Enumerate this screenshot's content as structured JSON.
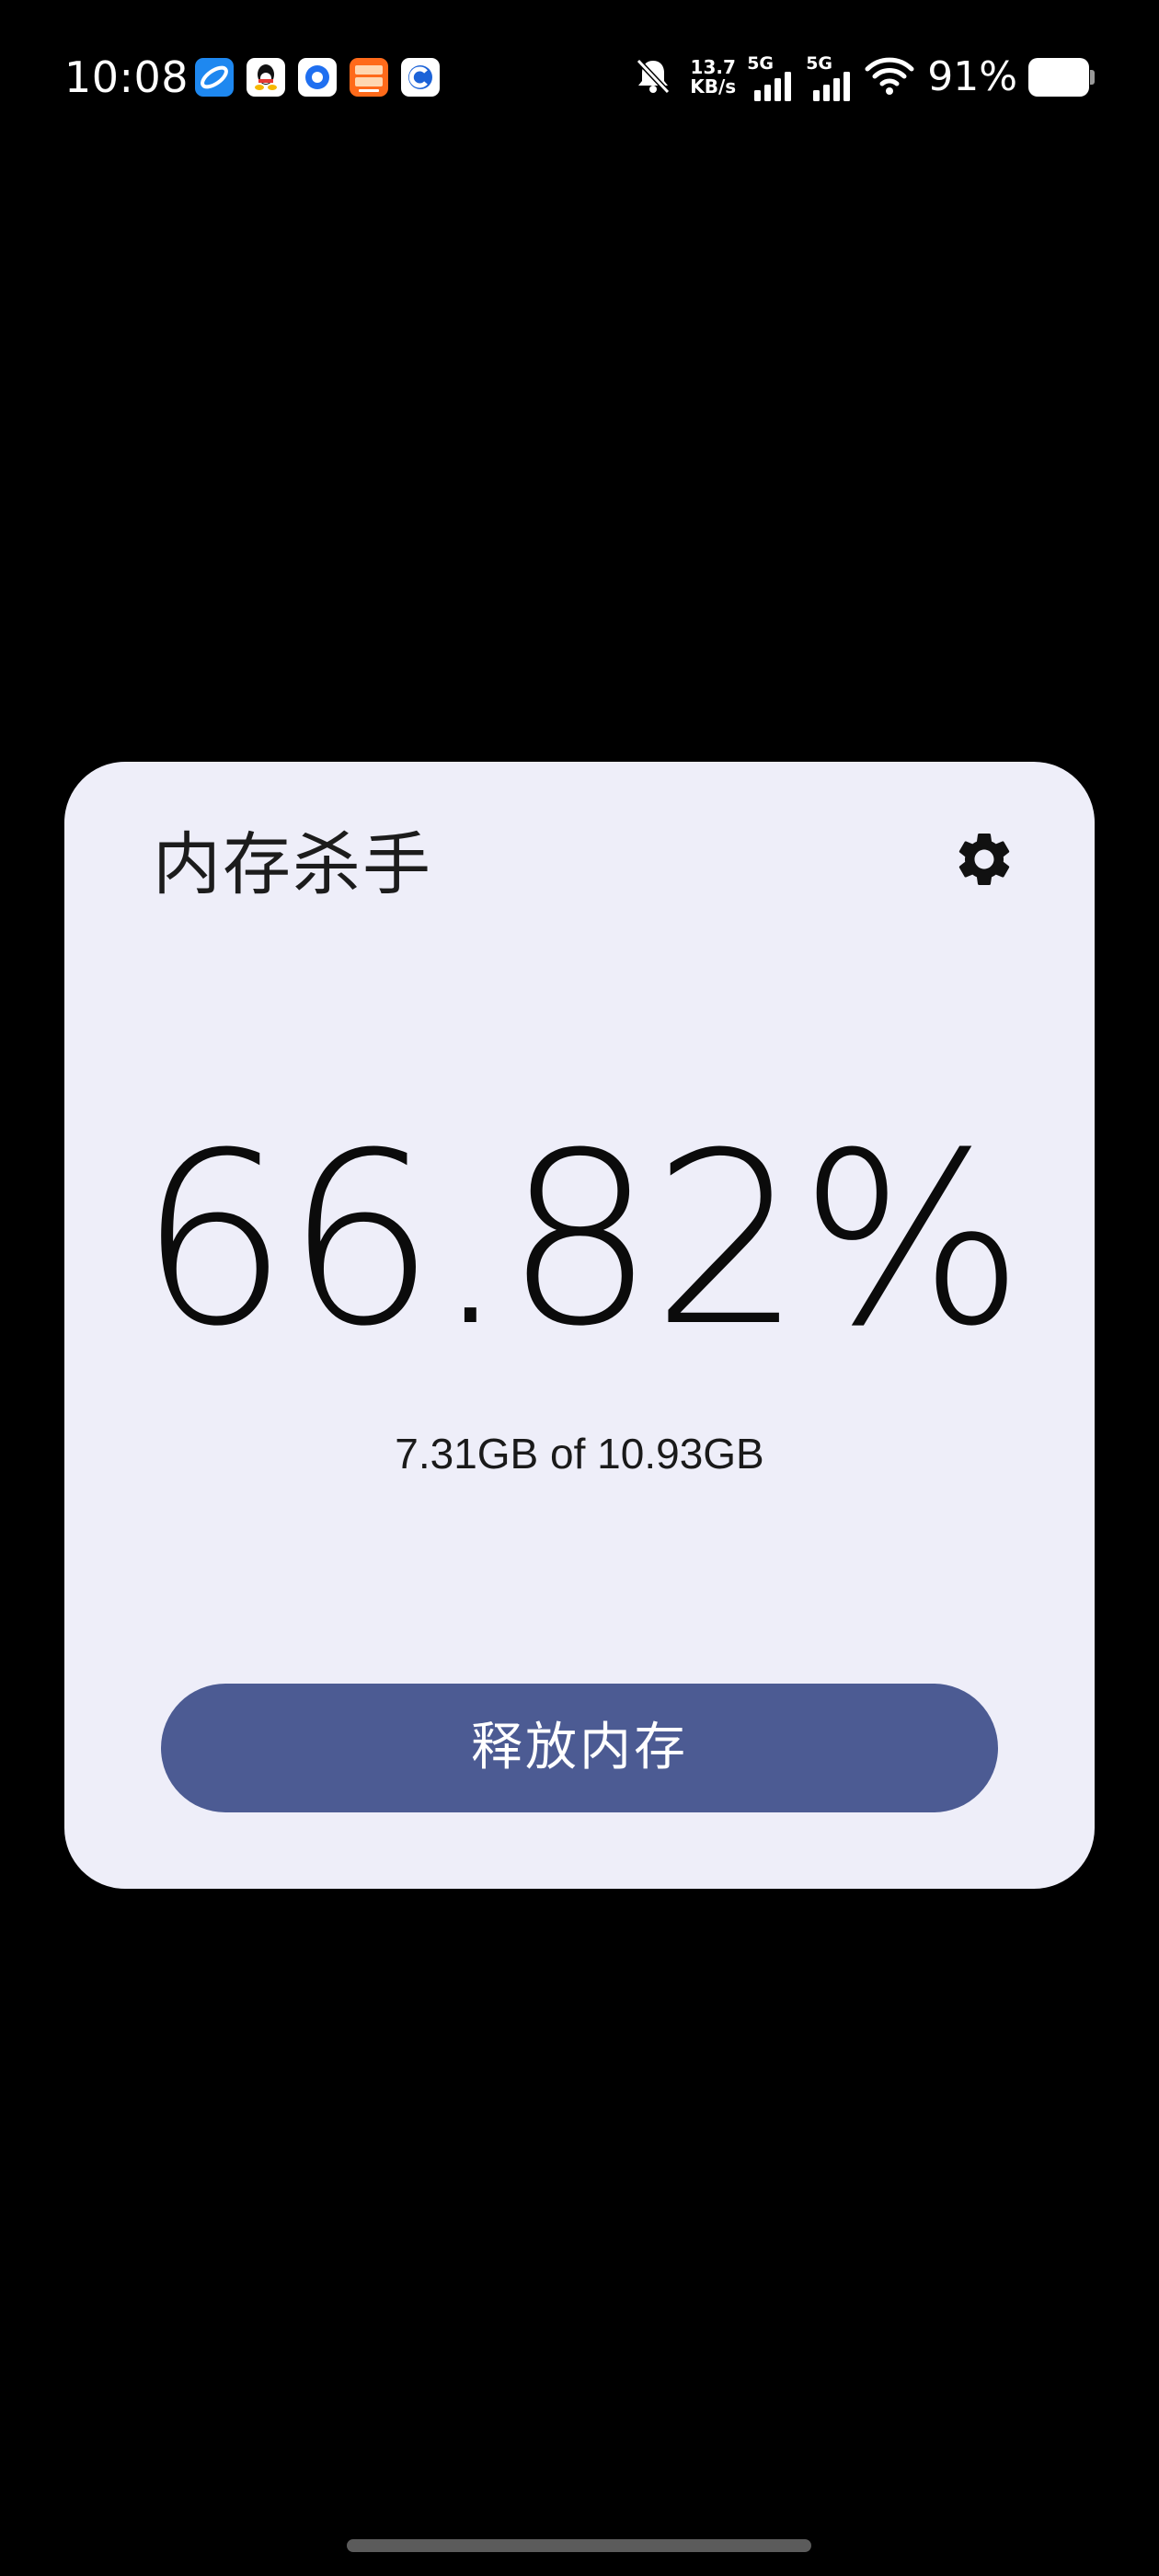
{
  "status_bar": {
    "time": "10:08",
    "notification_icons": [
      "browser-app-icon",
      "qq-app-icon",
      "circle-app-icon",
      "taobao-flash-app-icon",
      "c-app-icon"
    ],
    "mute_icon": "bell-off-icon",
    "net_speed_value": "13.7",
    "net_speed_unit": "KB/s",
    "sim1_label": "5G",
    "sim2_label": "5G",
    "wifi_icon": "wifi-icon",
    "battery_percent": "91%"
  },
  "widget": {
    "title": "内存杀手",
    "settings_icon": "gear-icon",
    "usage_percent": "66.82%",
    "usage_detail": "7.31GB of 10.93GB",
    "free_button_label": "释放内存",
    "colors": {
      "card_background": "#eeeef9",
      "button_background": "#4c5b93",
      "button_text": "#ffffff"
    }
  }
}
